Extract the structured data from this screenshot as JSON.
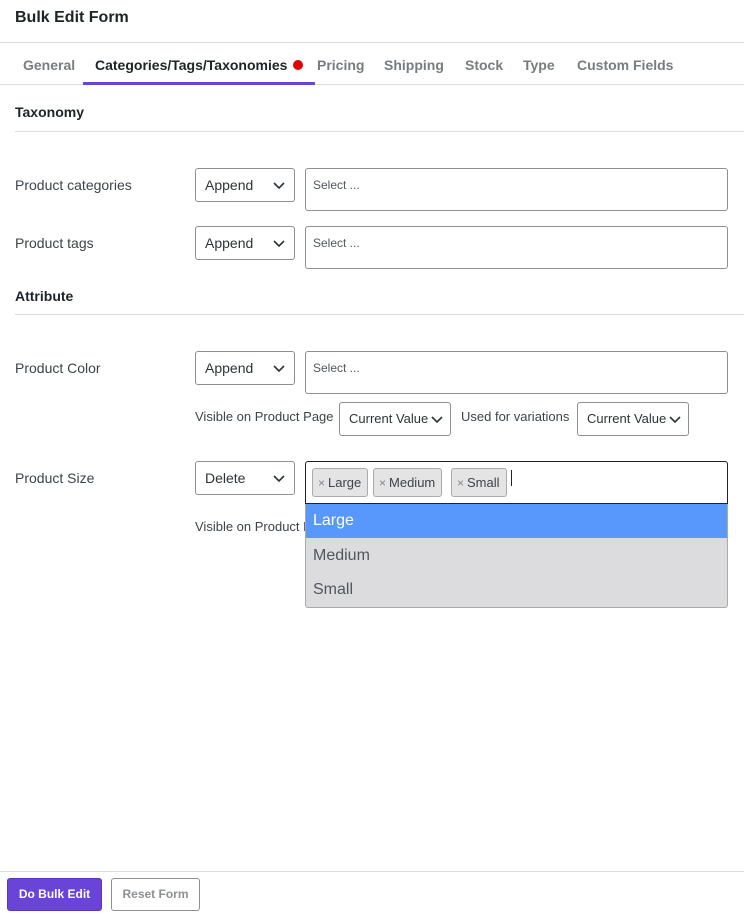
{
  "header": {
    "title": "Bulk Edit Form"
  },
  "tabs": [
    {
      "label": "General"
    },
    {
      "label": "Categories/Tags/Taxonomies"
    },
    {
      "label": "Pricing"
    },
    {
      "label": "Shipping"
    },
    {
      "label": "Stock"
    },
    {
      "label": "Type"
    },
    {
      "label": "Custom Fields"
    }
  ],
  "active_tab": "Categories/Tags/Taxonomies",
  "accent_color": "#6a43d8",
  "indicator_color": "#e00000",
  "taxonomy": {
    "title": "Taxonomy",
    "rows": [
      {
        "label": "Product categories",
        "action": "Append",
        "placeholder": "Select ..."
      },
      {
        "label": "Product tags",
        "action": "Append",
        "placeholder": "Select ..."
      }
    ]
  },
  "attribute": {
    "title": "Attribute",
    "color": {
      "label": "Product Color",
      "action": "Append",
      "placeholder": "Select ...",
      "visible_label": "Visible on Product Page",
      "visible_value": "Current Value",
      "variations_label": "Used for variations",
      "variations_value": "Current Value"
    },
    "size": {
      "label": "Product Size",
      "action": "Delete",
      "selected": [
        "Large",
        "Medium",
        "Small"
      ],
      "visible_label_partial": "Visible on Product P",
      "options": [
        "Large",
        "Medium",
        "Small"
      ],
      "highlighted": "Large",
      "highlight_color": "#5897fb"
    }
  },
  "footer": {
    "primary": "Do Bulk Edit",
    "secondary": "Reset Form"
  }
}
